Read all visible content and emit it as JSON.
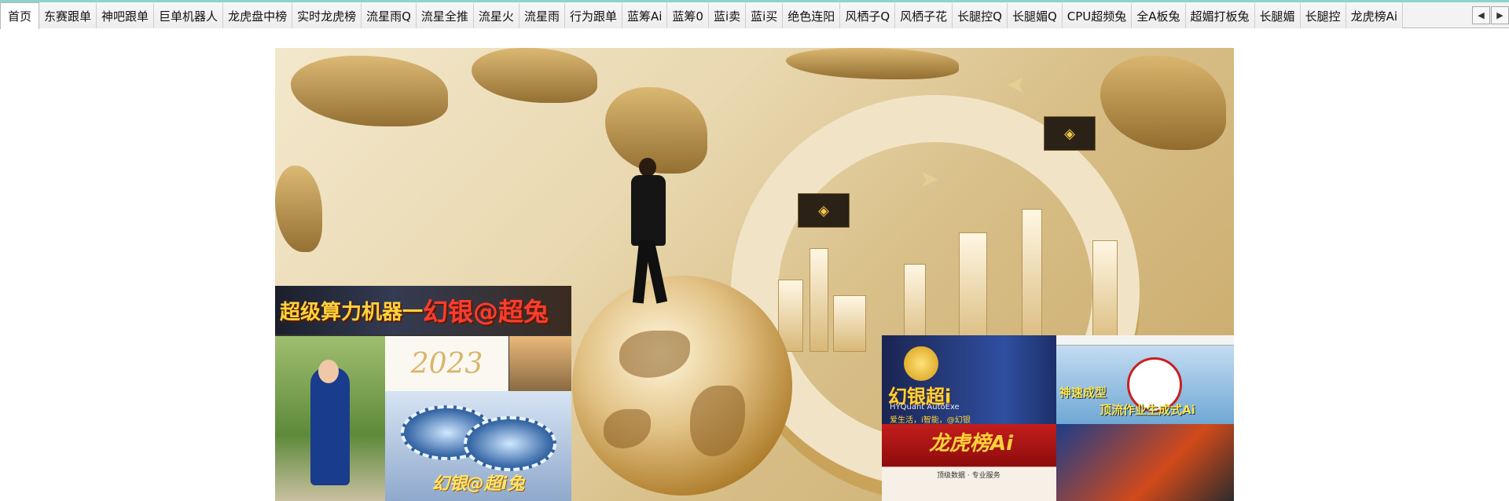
{
  "tabs": [
    {
      "label": "首页",
      "active": true
    },
    {
      "label": "东赛跟单"
    },
    {
      "label": "神吧跟单"
    },
    {
      "label": "巨单机器人"
    },
    {
      "label": "龙虎盘中榜"
    },
    {
      "label": "实时龙虎榜"
    },
    {
      "label": "流星雨Q"
    },
    {
      "label": "流星全推"
    },
    {
      "label": "流星火"
    },
    {
      "label": "流星雨"
    },
    {
      "label": "行为跟单"
    },
    {
      "label": "蓝筹Ai"
    },
    {
      "label": "蓝筹0"
    },
    {
      "label": "蓝i卖"
    },
    {
      "label": "蓝i买"
    },
    {
      "label": "绝色连阳"
    },
    {
      "label": "风栖子Q"
    },
    {
      "label": "风栖子花"
    },
    {
      "label": "长腿控Q"
    },
    {
      "label": "长腿媚Q"
    },
    {
      "label": "CPU超频兔"
    },
    {
      "label": "全A板兔"
    },
    {
      "label": "超媚打板兔"
    },
    {
      "label": "长腿媚"
    },
    {
      "label": "长腿控"
    },
    {
      "label": "龙虎榜Ai"
    }
  ],
  "scroll": {
    "left": "◀",
    "right": "▶"
  },
  "banner": {
    "left_header_a": "超级算力机器一",
    "left_header_b": "幻银@超",
    "left_header_c": "兔",
    "rabbit_text": "2023",
    "chips_slogan": "幻银@超i兔",
    "product_title": "幻银超i",
    "product_sub": "HYQuant AutoExe",
    "product_sub2": "爱生活，i智能，@幻银",
    "promo_line1": "神速成型",
    "promo_line2": "顶流作业生成式Ai",
    "dragon_title": "龙虎榜Ai",
    "dragon_line": "顶级数据 · 专业服务"
  }
}
